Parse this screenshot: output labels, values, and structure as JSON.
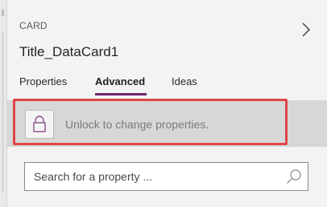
{
  "card": {
    "kicker": "CARD",
    "title": "Title_DataCard1"
  },
  "tabs": [
    {
      "label": "Properties",
      "active": false
    },
    {
      "label": "Advanced",
      "active": true
    },
    {
      "label": "Ideas",
      "active": false
    }
  ],
  "lock": {
    "message": "Unlock to change properties.",
    "icon": "lock-icon"
  },
  "search": {
    "placeholder": "Search for a property ...",
    "value": "",
    "icon": "search-icon"
  },
  "icons": {
    "chevron": "chevron-right-icon"
  },
  "colors": {
    "panel_bg": "#f3f3f3",
    "lock_bar_bg": "#d7d7d7",
    "tab_accent": "#742774",
    "highlight": "#e04646",
    "lock_icon": "#8a4f8a"
  }
}
